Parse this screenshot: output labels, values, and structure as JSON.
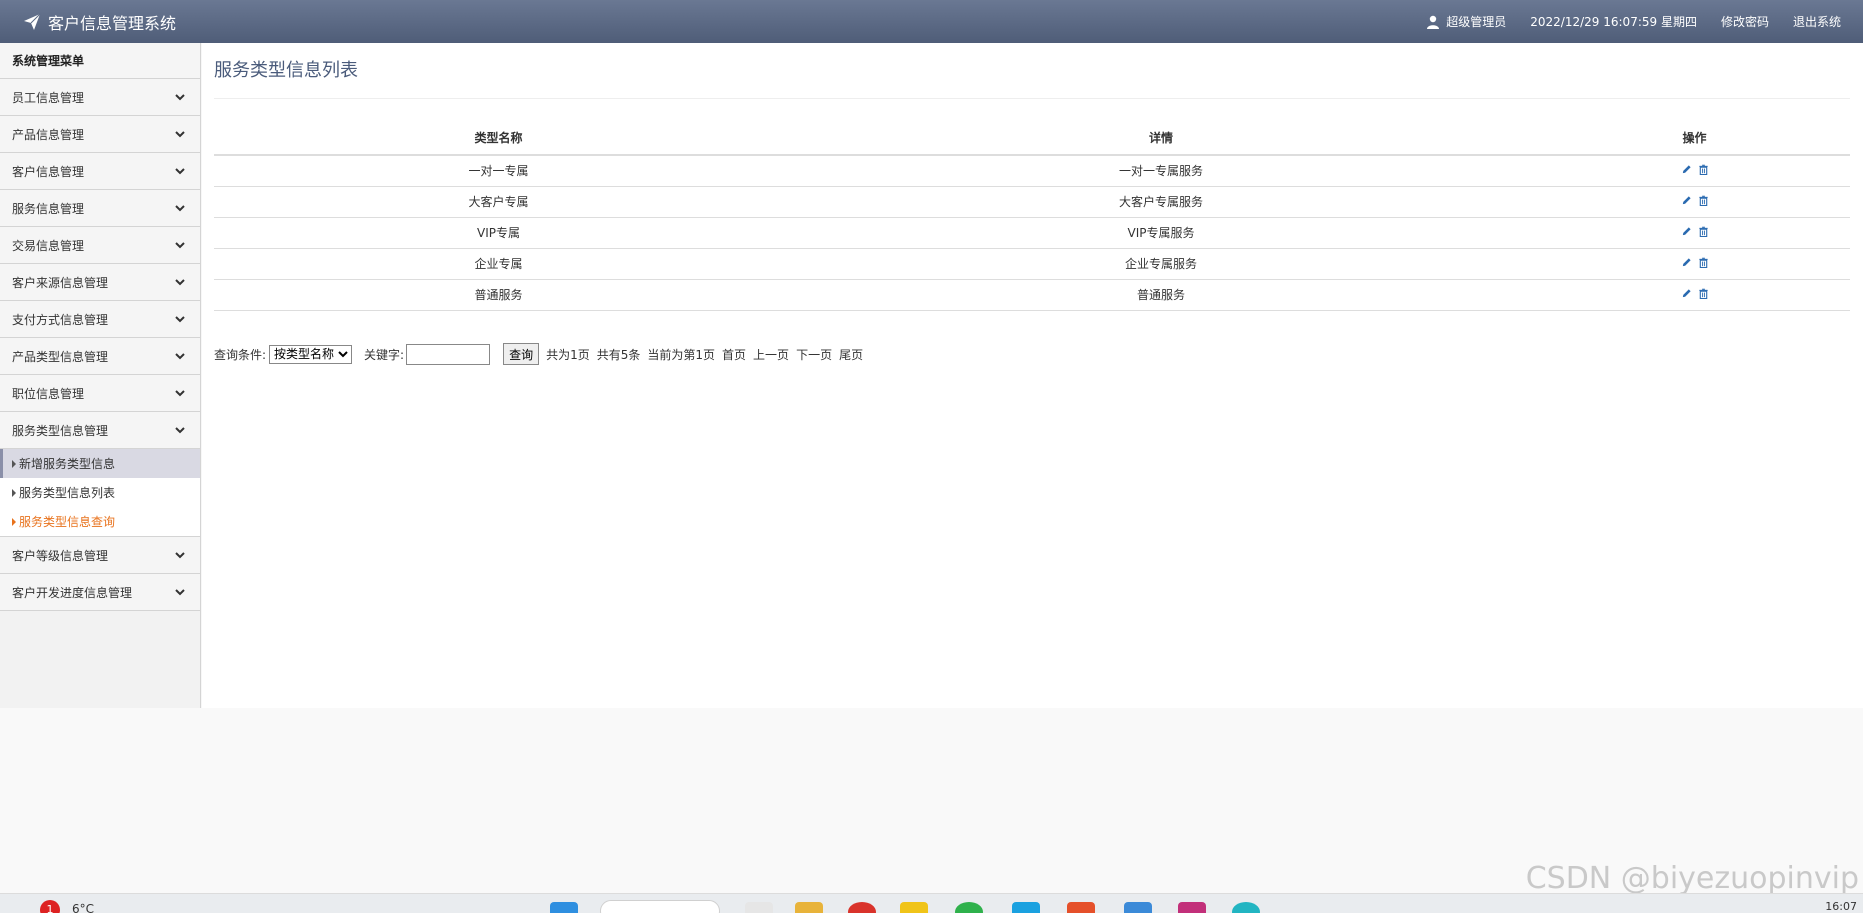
{
  "header": {
    "app_title": "客户信息管理系统",
    "user": "超级管理员",
    "datetime": "2022/12/29 16:07:59 星期四",
    "change_password": "修改密码",
    "logout": "退出系统",
    "brand_color": "#5a6883"
  },
  "sidebar": {
    "title": "系统管理菜单",
    "items": [
      {
        "label": "员工信息管理"
      },
      {
        "label": "产品信息管理"
      },
      {
        "label": "客户信息管理"
      },
      {
        "label": "服务信息管理"
      },
      {
        "label": "交易信息管理"
      },
      {
        "label": "客户来源信息管理"
      },
      {
        "label": "支付方式信息管理"
      },
      {
        "label": "产品类型信息管理"
      },
      {
        "label": "职位信息管理"
      },
      {
        "label": "服务类型信息管理"
      }
    ],
    "submenu": [
      {
        "label": "新增服务类型信息",
        "state": "active"
      },
      {
        "label": "服务类型信息列表",
        "state": "normal"
      },
      {
        "label": "服务类型信息查询",
        "state": "highlight"
      }
    ],
    "items_after": [
      {
        "label": "客户等级信息管理"
      },
      {
        "label": "客户开发进度信息管理"
      }
    ],
    "highlight_color": "#e8721c"
  },
  "main": {
    "page_title": "服务类型信息列表",
    "table": {
      "headers": [
        "类型名称",
        "详情",
        "操作"
      ],
      "rows": [
        {
          "name": "一对一专属",
          "detail": "一对一专属服务"
        },
        {
          "name": "大客户专属",
          "detail": "大客户专属服务"
        },
        {
          "name": "VIP专属",
          "detail": "VIP专属服务"
        },
        {
          "name": "企业专属",
          "detail": "企业专属服务"
        },
        {
          "name": "普通服务",
          "detail": "普通服务"
        }
      ],
      "row_actions": [
        "edit-icon",
        "delete-icon"
      ]
    },
    "query": {
      "condition_label": "查询条件:",
      "condition_selected": "按类型名称",
      "keyword_label": "关键字:",
      "keyword_value": "",
      "search_button": "查询",
      "total_pages": "共为1页",
      "total_records": "共有5条",
      "current_page": "当前为第1页",
      "first": "首页",
      "prev": "上一页",
      "next": "下一页",
      "last": "尾页"
    }
  },
  "footer": {
    "watermark": "CSDN @biyezuopinvip",
    "notification_count": "1",
    "temperature": "6°C",
    "clock": "16:07"
  }
}
